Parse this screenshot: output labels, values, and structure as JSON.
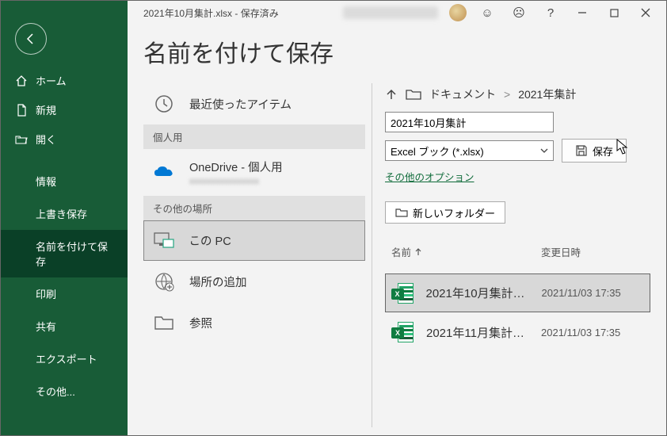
{
  "titlebar": {
    "filename": "2021年10月集計.xlsx - 保存済み"
  },
  "sidebar": {
    "home": "ホーム",
    "new": "新規",
    "open": "開く",
    "info": "情報",
    "save": "上書き保存",
    "saveas": "名前を付けて保存",
    "print": "印刷",
    "share": "共有",
    "export": "エクスポート",
    "other": "その他..."
  },
  "page": {
    "title": "名前を付けて保存"
  },
  "locations": {
    "recent": "最近使ったアイテム",
    "personal_header": "個人用",
    "onedrive": "OneDrive - 個人用",
    "onedrive_sub": "xxxxxxxxxxxxxxxx",
    "other_header": "その他の場所",
    "thispc": "この PC",
    "addplace": "場所の追加",
    "browse": "参照"
  },
  "right": {
    "breadcrumb_folder": "ドキュメント",
    "breadcrumb_sep": ">",
    "breadcrumb_current": "2021年集計",
    "filename_value": "2021年10月集計",
    "filetype": "Excel ブック (*.xlsx)",
    "save_btn": "保存",
    "more_options": "その他のオプション",
    "new_folder": "新しいフォルダー",
    "col_name": "名前",
    "col_date": "変更日時",
    "files": [
      {
        "name": "2021年10月集計…",
        "date": "2021/11/03 17:35"
      },
      {
        "name": "2021年11月集計…",
        "date": "2021/11/03 17:35"
      }
    ]
  }
}
